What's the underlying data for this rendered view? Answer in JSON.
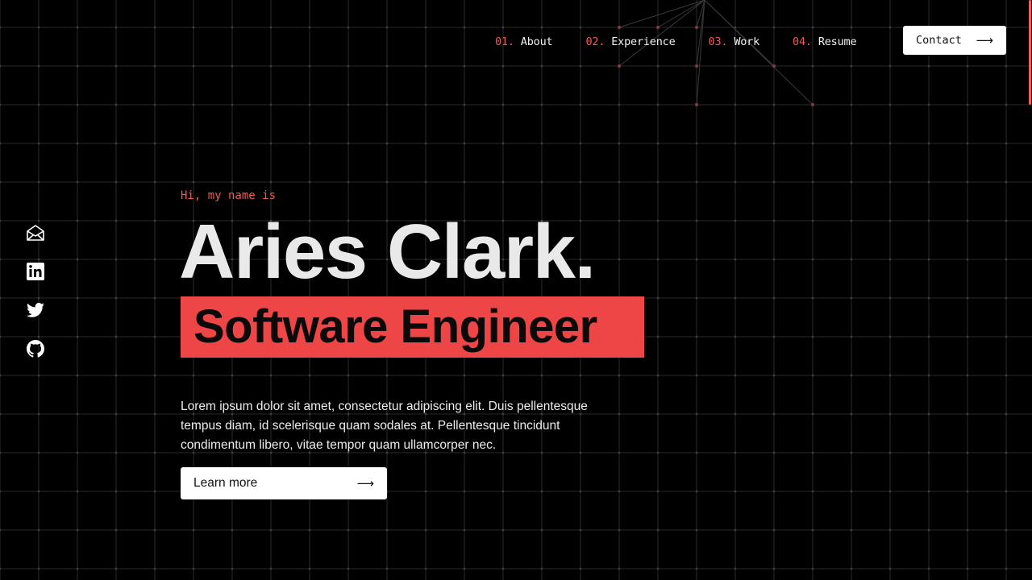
{
  "nav": {
    "items": [
      {
        "num": "01.",
        "label": "About"
      },
      {
        "num": "02.",
        "label": "Experience"
      },
      {
        "num": "03.",
        "label": "Work"
      },
      {
        "num": "04.",
        "label": "Resume"
      }
    ],
    "contact_label": "Contact",
    "contact_icon": "arrow-right-icon"
  },
  "social": {
    "icons": [
      "mail-icon",
      "linkedin-icon",
      "twitter-icon",
      "github-icon"
    ]
  },
  "hero": {
    "greeting": "Hi, my name is",
    "name": "Aries Clark.",
    "role": "Software Engineer",
    "description": "Lorem ipsum dolor sit amet, consectetur adipiscing elit. Duis pellentesque tempus diam, id scelerisque quam sodales at. Pellentesque tincidunt condimentum libero, vitae tempor quam ullamcorper nec.",
    "cta_label": "Learn more",
    "cta_icon": "arrow-right-icon"
  },
  "colors": {
    "background": "#000000",
    "accent": "#ee4546",
    "text": "#e9e9e9"
  }
}
